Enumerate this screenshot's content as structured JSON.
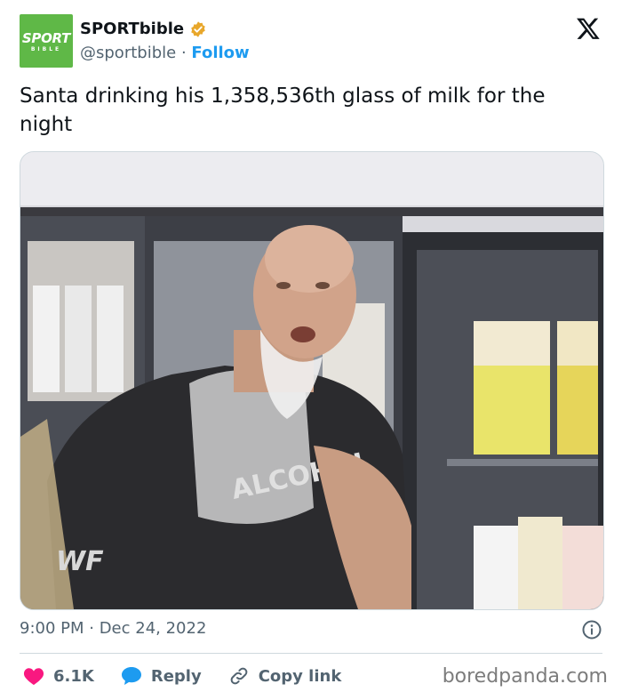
{
  "account": {
    "avatar_text_top": "SPORT",
    "avatar_text_bottom": "BIBLE",
    "name": "SPORTbible",
    "handle": "@sportbible",
    "separator": "·",
    "follow_label": "Follow"
  },
  "tweet": {
    "text": "Santa drinking his 1,358,536th glass of milk for the night",
    "media": {
      "shirt_text": "ALCOHOL",
      "logo_text": "WF"
    },
    "timestamp": "9:00 PM · Dec 24, 2022"
  },
  "actions": {
    "likes": "6.1K",
    "reply_label": "Reply",
    "copy_label": "Copy link"
  },
  "watermark": "boredpanda.com",
  "colors": {
    "accent": "#1d9bf0",
    "like": "#f91880",
    "reply_bubble": "#1d9bf0",
    "avatar_bg": "#5fb847",
    "verified": "#e8a72b",
    "text_primary": "#0f1419",
    "text_secondary": "#536471"
  },
  "icons": {
    "x_logo": "x-logo-icon",
    "verified": "verified-badge-icon",
    "info": "info-icon",
    "heart": "heart-icon",
    "reply": "reply-bubble-icon",
    "link": "link-icon"
  }
}
